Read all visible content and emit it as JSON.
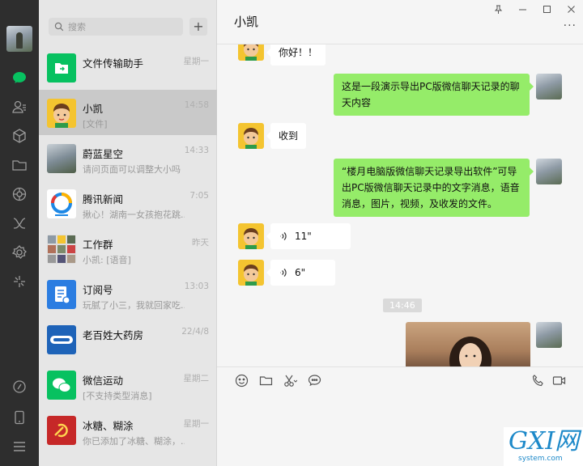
{
  "app": {
    "search_placeholder": "搜索",
    "add_label": "+"
  },
  "sidebar": {
    "icons": [
      "chat-icon",
      "contacts-icon",
      "favorites-icon",
      "folder-icon",
      "moments-icon",
      "mini-program-icon",
      "settings-gear-icon",
      "search-discover-icon",
      "phone-icon",
      "menu-icon"
    ]
  },
  "chats": [
    {
      "name": "文件传输助手",
      "preview": "",
      "time": "星期一"
    },
    {
      "name": "小凯",
      "preview": "[文件]",
      "time": "14:58"
    },
    {
      "name": "蔚蓝星空",
      "preview": "请问页面可以调整大小吗",
      "time": "14:33"
    },
    {
      "name": "腾讯新闻",
      "preview": "揪心！湖南一女孩抱花跳...",
      "time": "7:05"
    },
    {
      "name": "工作群",
      "preview": "小凯: [语音]",
      "time": "昨天"
    },
    {
      "name": "订阅号",
      "preview": "玩腻了小三，我就回家吃...",
      "time": "13:03"
    },
    {
      "name": "老百姓大药房",
      "preview": "",
      "time": "22/4/8"
    },
    {
      "name": "微信运动",
      "preview": "[不支持类型消息]",
      "time": "星期二"
    },
    {
      "name": "冰糖、糊涂",
      "preview": "你已添加了冰糖、糊涂，...",
      "time": "星期一"
    }
  ],
  "conversation": {
    "title": "小凯",
    "window_controls": [
      "pin",
      "minimize",
      "maximize",
      "close"
    ],
    "more_label": "···",
    "messages": [
      {
        "side": "in",
        "text": "你好！！"
      },
      {
        "side": "out",
        "text": "这是一段演示导出PC版微信聊天记录的聊天内容"
      },
      {
        "side": "in",
        "text": "收到"
      },
      {
        "side": "out",
        "text": "“楼月电脑版微信聊天记录导出软件”可导出PC版微信聊天记录中的文字消息，语音消息，图片，视频，及收发的文件。"
      },
      {
        "side": "in",
        "type": "voice",
        "text": "11\""
      },
      {
        "side": "in",
        "type": "voice",
        "text": "6\""
      },
      {
        "type": "timestamp",
        "text": "14:46"
      },
      {
        "side": "out",
        "type": "image",
        "text": ""
      }
    ],
    "tools": [
      "emoji-icon",
      "folder-icon",
      "scissors-icon",
      "chat-bubble-icon"
    ],
    "call_tools": [
      "voice-call-icon",
      "video-call-icon"
    ]
  },
  "watermark": {
    "main": "GXI网",
    "sub": "system.com"
  },
  "colors": {
    "rail": "#2e2e2e",
    "accent": "#07c160",
    "bubble_out": "#95ec69",
    "list_bg": "#e6e6e6",
    "selected": "#c9c9c9"
  }
}
